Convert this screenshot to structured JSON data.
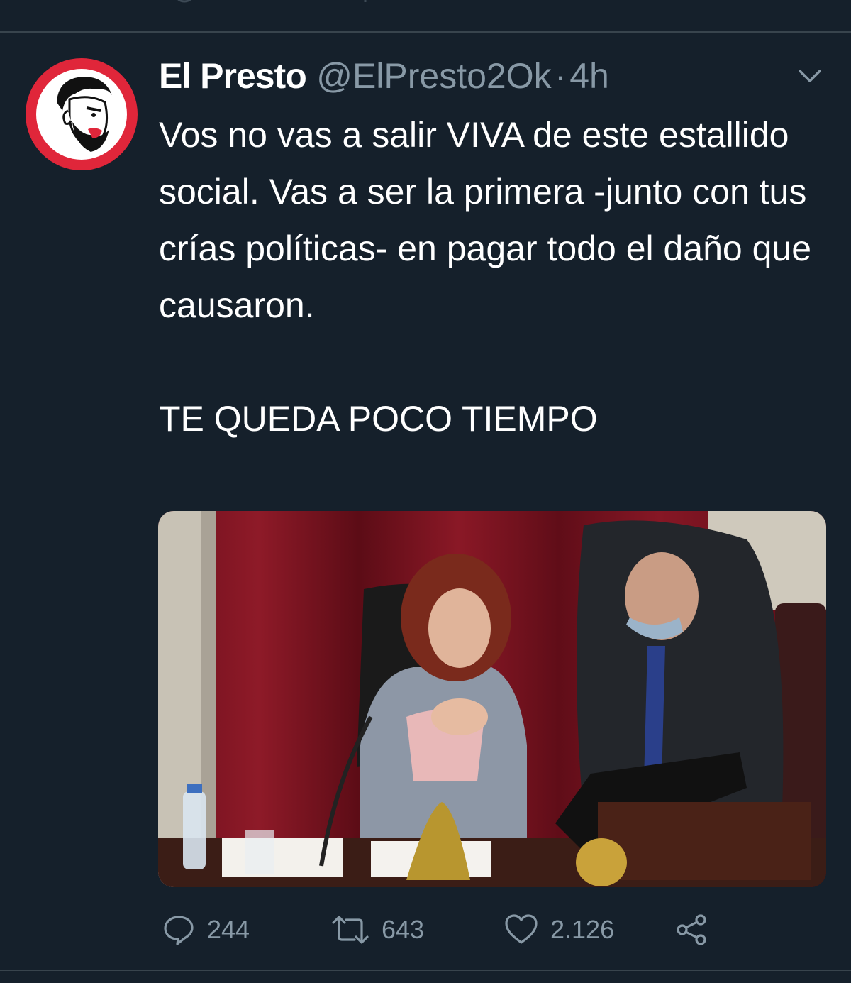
{
  "tweet": {
    "author_name": "El Presto",
    "handle": "@ElPresto2Ok",
    "separator": "·",
    "time": "4h",
    "text_paragraph_1": "Vos no vas a salir VIVA de este estallido social. Vas a ser la primera -junto con tus crías políticas- en pagar todo el daño que causaron.",
    "text_paragraph_2": "TE QUEDA POCO TIEMPO"
  },
  "actions": {
    "replies": "244",
    "retweets": "643",
    "likes": "2.126"
  },
  "icons": {
    "reply": "reply-bubble-icon",
    "retweet": "retweet-arrows-icon",
    "like": "heart-icon",
    "share": "share-icon",
    "menu": "chevron-down-icon"
  },
  "colors": {
    "background": "#15202b",
    "muted": "#8899a6",
    "divider": "#38444d",
    "avatar_ring": "#e0263a"
  }
}
